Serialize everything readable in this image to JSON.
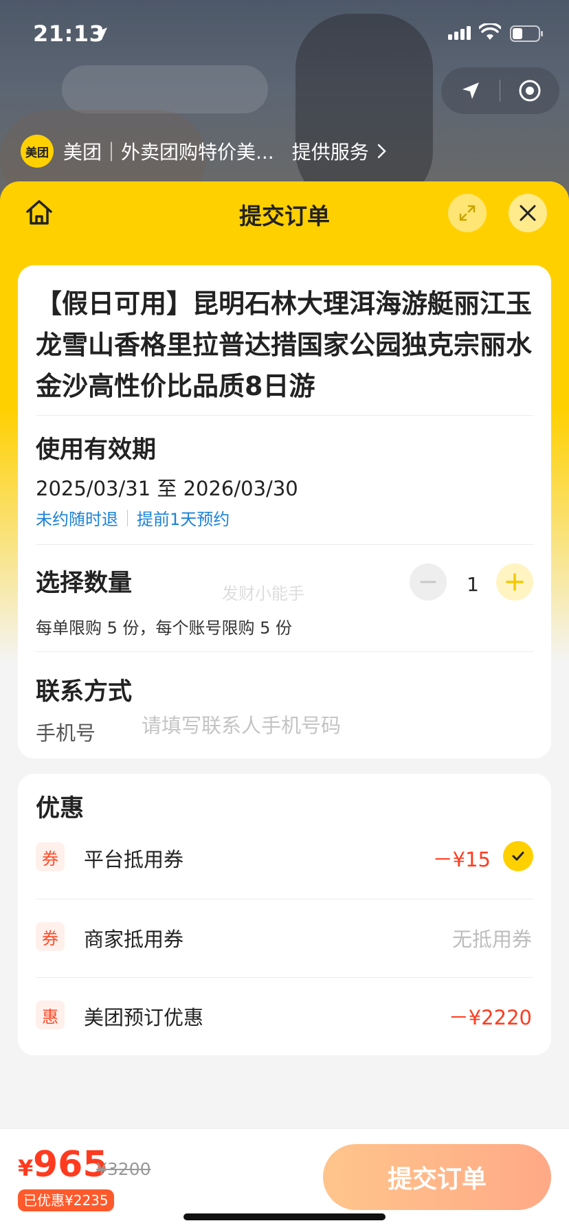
{
  "status_bar": {
    "time": "21:13"
  },
  "service": {
    "logo_text": "美团",
    "name": "美团｜外卖团购特价美...",
    "provide": "提供服务"
  },
  "sheet": {
    "title": "提交订单"
  },
  "product": {
    "title": "【假日可用】昆明石林大理洱海游艇丽江玉龙雪山香格里拉普达措国家公园独克宗丽水金沙高性价比品质8日游"
  },
  "validity": {
    "title": "使用有效期",
    "dates": "2025/03/31 至 2026/03/30",
    "tag1": "未约随时退",
    "tag2": "提前1天预约"
  },
  "quantity": {
    "title": "选择数量",
    "watermark": "发财小能手",
    "value": "1",
    "limit": "每单限购 5 份，每个账号限购 5 份"
  },
  "contact": {
    "title": "联系方式",
    "phone_label": "手机号",
    "phone_placeholder": "请填写联系人手机号码",
    "phone_value": ""
  },
  "discounts": {
    "title": "优惠",
    "items": [
      {
        "icon": "券",
        "label": "平台抵用券",
        "value": "－¥15",
        "selected": true
      },
      {
        "icon": "券",
        "label": "商家抵用券",
        "value": "无抵用券"
      },
      {
        "icon": "惠",
        "label": "美团预订优惠",
        "value": "－¥2220"
      }
    ]
  },
  "bottom": {
    "currency": "¥",
    "price": "965",
    "original_price": "¥3200",
    "saved": "已优惠¥2235",
    "submit_label": "提交订单"
  },
  "colors": {
    "brand_yellow": "#ffd000",
    "price_red": "#ff3b1f",
    "link_blue": "#1a82d6",
    "submit_gradient_start": "#ffc58c",
    "submit_gradient_end": "#ffa986"
  }
}
